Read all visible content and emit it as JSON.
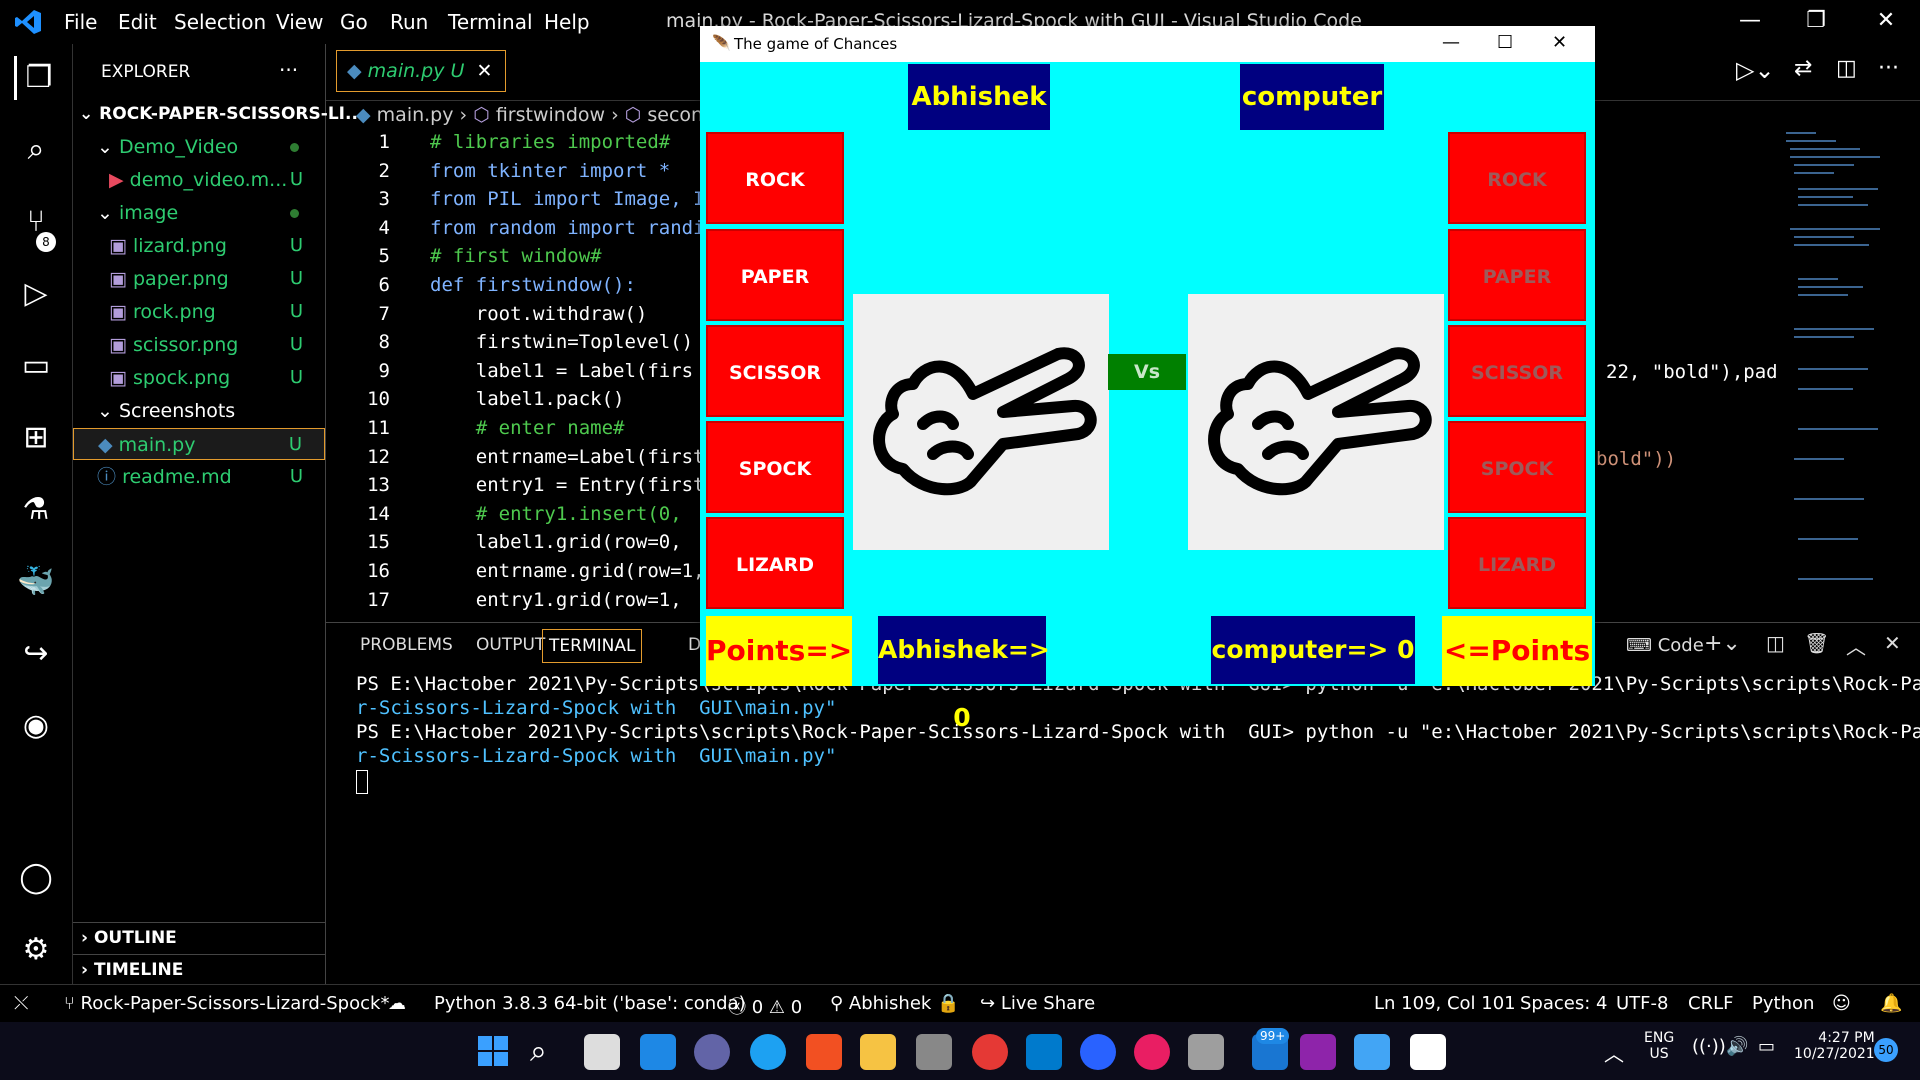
{
  "menu": [
    "File",
    "Edit",
    "Selection",
    "View",
    "Go",
    "Run",
    "Terminal",
    "Help"
  ],
  "window_title": "main.py - Rock-Paper-Scissors-Lizard-Spock with GUI - Visual Studio Code",
  "explorer": {
    "header": "EXPLORER",
    "more": "···",
    "root": "ROCK-PAPER-SCISSORS-LI...",
    "items": [
      {
        "label": "Demo_Video",
        "kind": "folder",
        "badge": ""
      },
      {
        "label": "demo_video.m...",
        "kind": "file",
        "badge": "U"
      },
      {
        "label": "image",
        "kind": "folder",
        "badge": ""
      },
      {
        "label": "lizard.png",
        "kind": "file",
        "badge": "U"
      },
      {
        "label": "paper.png",
        "kind": "file",
        "badge": "U"
      },
      {
        "label": "rock.png",
        "kind": "file",
        "badge": "U"
      },
      {
        "label": "scissor.png",
        "kind": "file",
        "badge": "U"
      },
      {
        "label": "spock.png",
        "kind": "file",
        "badge": "U"
      },
      {
        "label": "Screenshots",
        "kind": "folder",
        "badge": ""
      },
      {
        "label": "main.py",
        "kind": "file",
        "badge": "U"
      },
      {
        "label": "readme.md",
        "kind": "file",
        "badge": "U"
      }
    ],
    "outline": "OUTLINE",
    "timeline": "TIMELINE"
  },
  "activity_badge": "8",
  "editor": {
    "tab_label": "main.py",
    "tab_badge": "U",
    "breadcrumbs": [
      "main.py",
      "firstwindow",
      "secon"
    ],
    "lines": [
      {
        "n": "1",
        "text": "# libraries imported#"
      },
      {
        "n": "2",
        "text": "from tkinter import *"
      },
      {
        "n": "3",
        "text": "from PIL import Image, I"
      },
      {
        "n": "4",
        "text": "from random import randi"
      },
      {
        "n": "5",
        "text": "# first window#"
      },
      {
        "n": "6",
        "text": "def firstwindow():"
      },
      {
        "n": "7",
        "text": "    root.withdraw()"
      },
      {
        "n": "8",
        "text": "    firstwin=Toplevel()"
      },
      {
        "n": "9",
        "text": "    label1 = Label(firs"
      },
      {
        "n": "10",
        "text": "    label1.pack()"
      },
      {
        "n": "11",
        "text": "    # enter name#"
      },
      {
        "n": "12",
        "text": "    entrname=Label(first"
      },
      {
        "n": "13",
        "text": "    entry1 = Entry(first"
      },
      {
        "n": "14",
        "text": "    # entry1.insert(0, "
      },
      {
        "n": "15",
        "text": "    label1.grid(row=0, "
      },
      {
        "n": "16",
        "text": "    entrname.grid(row=1,"
      },
      {
        "n": "17",
        "text": "    entry1.grid(row=1, "
      }
    ],
    "line9_tail": "22, \"bold\"),pad",
    "line12_tail": "bold\"))"
  },
  "panel": {
    "tabs": [
      "PROBLEMS",
      "OUTPUT",
      "TERMINAL",
      "D"
    ],
    "shell": "Code",
    "terminal_lines": [
      "PS E:\\Hactober 2021\\Py-Scripts\\scripts\\Rock-Paper-Scissors-Lizard-Spock with  GUI> python -u \"e:\\Hactober 2021\\Py-Scripts\\scripts\\Rock-Pape",
      "r-Scissors-Lizard-Spock with  GUI\\main.py\"",
      "PS E:\\Hactober 2021\\Py-Scripts\\scripts\\Rock-Paper-Scissors-Lizard-Spock with  GUI> python -u \"e:\\Hactober 2021\\Py-Scripts\\scripts\\Rock-Pape",
      "r-Scissors-Lizard-Spock with  GUI\\main.py\""
    ]
  },
  "game": {
    "title": "The game of Chances",
    "player_name": "Abhishek",
    "computer_name": "computer",
    "choices": [
      "ROCK",
      "PAPER",
      "SCISSOR",
      "SPOCK",
      "LIZARD"
    ],
    "vs": "Vs",
    "points_left": "Points=>",
    "points_right": "<=Points",
    "player_score": "Abhishek=> 0",
    "computer_score": "computer=> 0",
    "colors": {
      "bg": "#00ffff",
      "button": "#ff0000",
      "name_bg": "#000080",
      "name_fg": "#ffff00",
      "vs_bg": "#008000"
    }
  },
  "status": {
    "branch": "Rock-Paper-Scissors-Lizard-Spock*",
    "python": "Python 3.8.3 64-bit ('base': conda)",
    "errors": "0",
    "warnings": "0",
    "user": "Abhishek",
    "live_share": "Live Share",
    "position": "Ln 109, Col 101",
    "spaces": "Spaces: 4",
    "encoding": "UTF-8",
    "eol": "CRLF",
    "language": "Python"
  },
  "taskbar": {
    "lang": "ENG",
    "region": "US",
    "time": "4:27 PM",
    "date": "10/27/2021",
    "notif": "50",
    "teams_badge": "99+"
  }
}
